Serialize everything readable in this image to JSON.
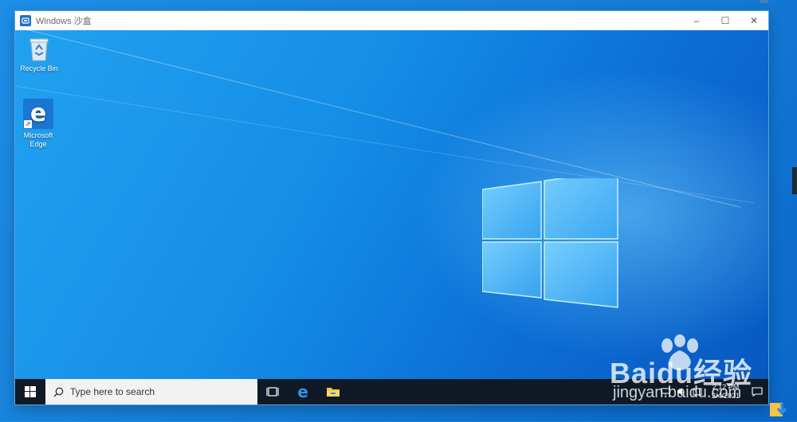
{
  "window": {
    "title": "Windows 沙盒",
    "minimize_label": "–",
    "maximize_label": "☐",
    "close_label": "✕"
  },
  "desktop": {
    "icons": [
      {
        "label": "Recycle Bin",
        "icon": "recycle-bin-icon"
      },
      {
        "label": "Microsoft Edge",
        "icon": "edge-icon"
      }
    ]
  },
  "taskbar": {
    "search_placeholder": "Type here to search",
    "clock_time": "2:12 PM",
    "clock_date": "2/4/2021",
    "pinned": [
      "task-view-icon",
      "edge-icon",
      "file-explorer-icon"
    ]
  },
  "watermark": {
    "brand": "Baidu经验",
    "url": "jingyan.baidu.com"
  },
  "colors": {
    "accent": "#0b74d8",
    "taskbar": "#101a26",
    "edge_blue": "#1a76d2"
  }
}
